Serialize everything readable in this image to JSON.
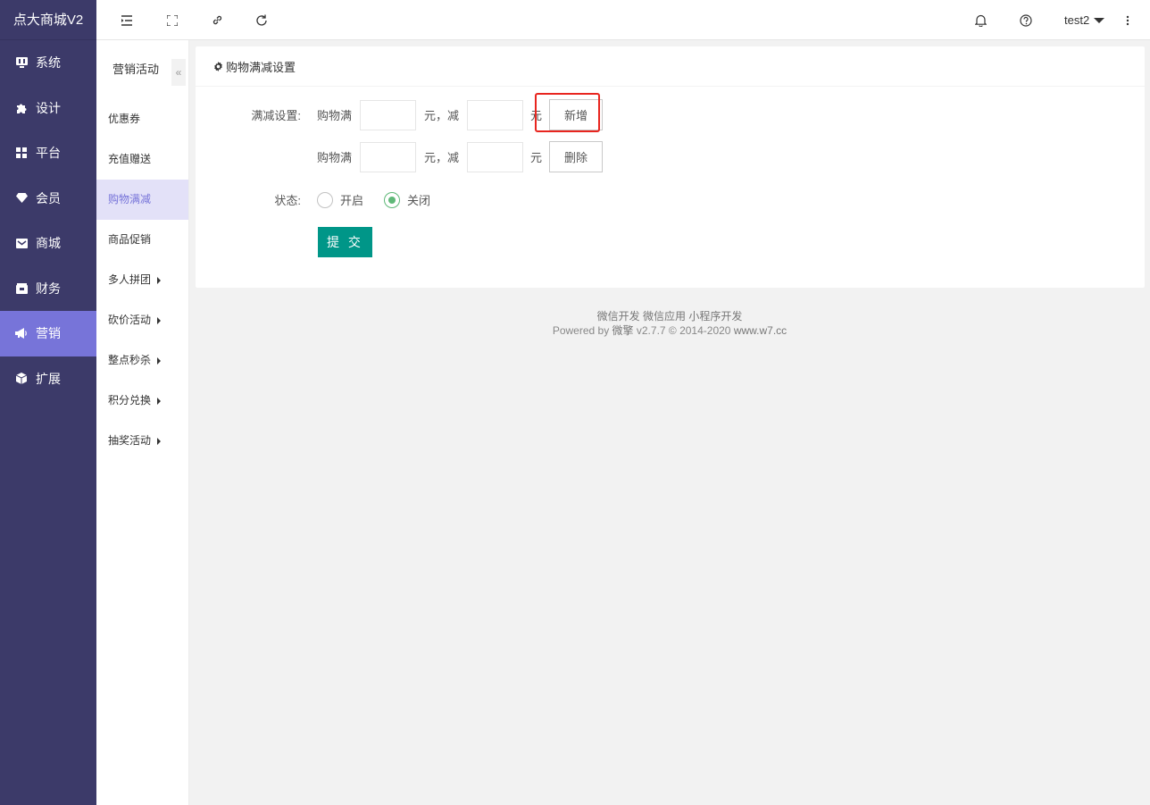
{
  "brand": "点大商城V2",
  "sidebar": {
    "items": [
      {
        "label": "系统",
        "icon": "monitor-icon"
      },
      {
        "label": "设计",
        "icon": "puzzle-icon"
      },
      {
        "label": "平台",
        "icon": "grid-icon"
      },
      {
        "label": "会员",
        "icon": "diamond-icon"
      },
      {
        "label": "商城",
        "icon": "mail-icon"
      },
      {
        "label": "财务",
        "icon": "wallet-icon"
      },
      {
        "label": "营销",
        "icon": "megaphone-icon",
        "active": true
      },
      {
        "label": "扩展",
        "icon": "cube-icon"
      }
    ]
  },
  "header": {
    "user": "test2"
  },
  "subnav": {
    "title": "营销活动",
    "collapse": "«",
    "items": [
      {
        "label": "优惠券"
      },
      {
        "label": "充值赠送"
      },
      {
        "label": "购物满减",
        "active": true
      },
      {
        "label": "商品促销"
      },
      {
        "label": "多人拼团",
        "has_children": true
      },
      {
        "label": "砍价活动",
        "has_children": true
      },
      {
        "label": "整点秒杀",
        "has_children": true
      },
      {
        "label": "积分兑换",
        "has_children": true
      },
      {
        "label": "抽奖活动",
        "has_children": true
      }
    ]
  },
  "card": {
    "title": "购物满减设置",
    "discount_label": "满减设置:",
    "rows": [
      {
        "prefix": "购物满",
        "value1": "",
        "mid": "元，减",
        "value2": "",
        "suffix": "元",
        "button": "新增"
      },
      {
        "prefix": "购物满",
        "value1": "",
        "mid": "元，减",
        "value2": "",
        "suffix": "元",
        "button": "删除"
      }
    ],
    "status_label": "状态:",
    "status_options": [
      {
        "label": "开启",
        "checked": false
      },
      {
        "label": "关闭",
        "checked": true
      }
    ],
    "submit": "提 交"
  },
  "footer": {
    "line1": "微信开发 微信应用 小程序开发",
    "powered_prefix": "Powered by ",
    "brand": "微擎",
    "version": " v2.7.7 © 2014-2020 ",
    "site": "www.w7.cc"
  },
  "colors": {
    "sidebar_bg": "#3c3a69",
    "sidebar_active": "#7774d9",
    "submit_green": "#009688",
    "radio_green": "#5fb878",
    "highlight_red": "#e8251f"
  }
}
